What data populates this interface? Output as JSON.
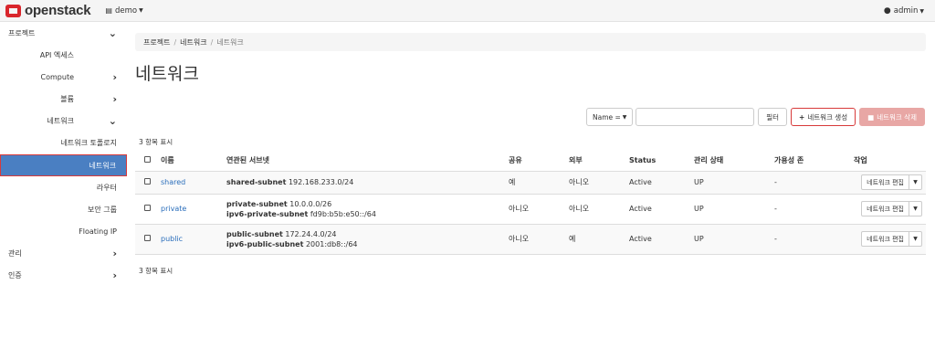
{
  "header": {
    "brand": "openstack",
    "project": "demo",
    "user": "admin"
  },
  "sidebar": {
    "items": [
      {
        "label": "프로젝트"
      },
      {
        "label": "API 엑세스"
      },
      {
        "label": "Compute"
      },
      {
        "label": "볼륨"
      },
      {
        "label": "네트워크"
      },
      {
        "label": "네트워크 토폴로지"
      },
      {
        "label": "네트워크"
      },
      {
        "label": "라우터"
      },
      {
        "label": "보안 그룹"
      },
      {
        "label": "Floating IP"
      },
      {
        "label": "관리"
      },
      {
        "label": "인증"
      }
    ]
  },
  "breadcrumb": [
    "프로젝트",
    "네트워크",
    "네트워크"
  ],
  "page_title": "네트워크",
  "toolbar": {
    "filter_field": "Name =",
    "filter_value": "",
    "filter_button": "필터",
    "create_button": "네트워크 생성",
    "delete_button": "네트워크 삭제"
  },
  "count_text": "3 항목 표시",
  "table": {
    "columns": [
      "이름",
      "연관된 서브넷",
      "공유",
      "외부",
      "Status",
      "관리 상태",
      "가용성 존",
      "작업"
    ],
    "rows": [
      {
        "name": "shared",
        "subnets": [
          {
            "name": "shared-subnet",
            "cidr": "192.168.233.0/24"
          }
        ],
        "shared": "예",
        "external": "아니오",
        "status": "Active",
        "admin_state": "UP",
        "az": "-",
        "action": "네트워크 편집"
      },
      {
        "name": "private",
        "subnets": [
          {
            "name": "private-subnet",
            "cidr": "10.0.0.0/26"
          },
          {
            "name": "ipv6-private-subnet",
            "cidr": "fd9b:b5b:e50::/64"
          }
        ],
        "shared": "아니오",
        "external": "아니오",
        "status": "Active",
        "admin_state": "UP",
        "az": "-",
        "action": "네트워크 편집"
      },
      {
        "name": "public",
        "subnets": [
          {
            "name": "public-subnet",
            "cidr": "172.24.4.0/24"
          },
          {
            "name": "ipv6-public-subnet",
            "cidr": "2001:db8::/64"
          }
        ],
        "shared": "아니오",
        "external": "예",
        "status": "Active",
        "admin_state": "UP",
        "az": "-",
        "action": "네트워크 편집"
      }
    ]
  },
  "colors": {
    "link": "#2a6ebb",
    "sidebar_active": "#4a7fc2",
    "delete_button": "#e8a7a5",
    "brand_red": "#d9262c"
  }
}
